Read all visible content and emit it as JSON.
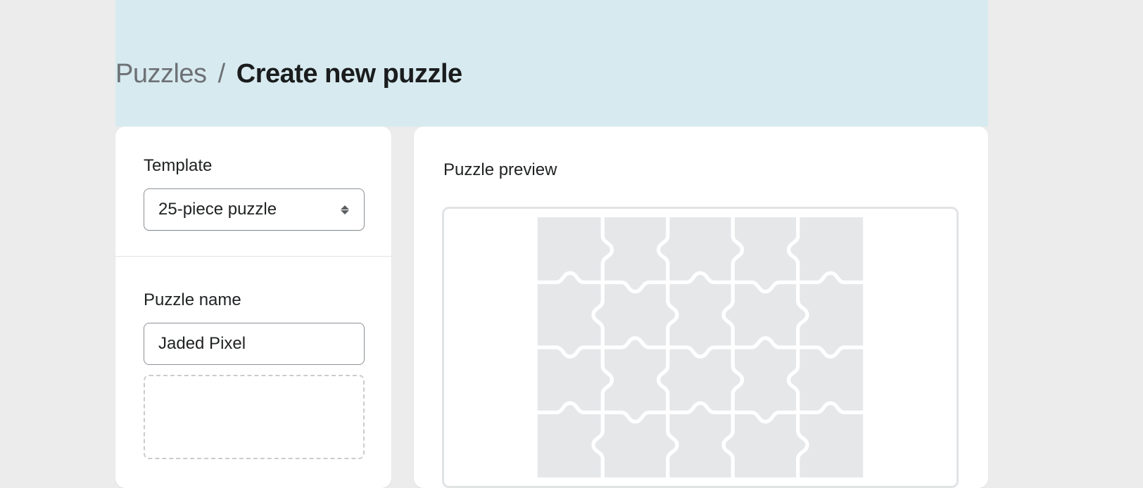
{
  "breadcrumb": {
    "root": "Puzzles",
    "separator": "/",
    "current": "Create new puzzle"
  },
  "form": {
    "template_label": "Template",
    "template_value": "25-piece puzzle",
    "name_label": "Puzzle name",
    "name_value": "Jaded Pixel"
  },
  "preview": {
    "title": "Puzzle preview"
  }
}
